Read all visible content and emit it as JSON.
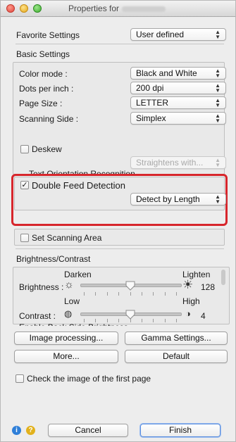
{
  "window": {
    "title": "Properties for"
  },
  "favorite": {
    "label": "Favorite Settings",
    "value": "User defined"
  },
  "basic": {
    "header": "Basic Settings",
    "color_mode": {
      "label": "Color mode :",
      "value": "Black and White"
    },
    "dpi": {
      "label": "Dots per inch :",
      "value": "200 dpi"
    },
    "page_size": {
      "label": "Page Size :",
      "value": "LETTER"
    },
    "scanning_side": {
      "label": "Scanning Side :",
      "value": "Simplex"
    },
    "deskew": {
      "label": "Deskew",
      "checked": false
    },
    "straighten": {
      "value": "Straightens with..."
    },
    "text_orientation": {
      "label": "Text Orientation Recognition"
    },
    "double_feed": {
      "label": "Double Feed Detection",
      "checked": true,
      "value": "Detect by Length"
    },
    "scan_area": {
      "label": "Set Scanning Area",
      "checked": false
    }
  },
  "brightness_contrast": {
    "header": "Brightness/Contrast",
    "brightness": {
      "label": "Brightness :",
      "min_label": "Darken",
      "max_label": "Lighten",
      "value": "128",
      "level": 0.5
    },
    "contrast": {
      "label": "Contrast :",
      "min_label": "Low",
      "max_label": "High",
      "value": "4",
      "level": 0.5
    },
    "back_side": {
      "label": "Enable Back Side Brightness"
    }
  },
  "buttons": {
    "image_processing": "Image processing...",
    "gamma": "Gamma Settings...",
    "more": "More...",
    "default": "Default",
    "cancel": "Cancel",
    "finish": "Finish"
  },
  "check_first_page": {
    "label": "Check the image of the first page",
    "checked": false
  },
  "icons": {
    "info": "info-icon",
    "help": "help-icon"
  },
  "colors": {
    "highlight_frame": "#d7262c",
    "primary_button": "#5c8ede"
  }
}
